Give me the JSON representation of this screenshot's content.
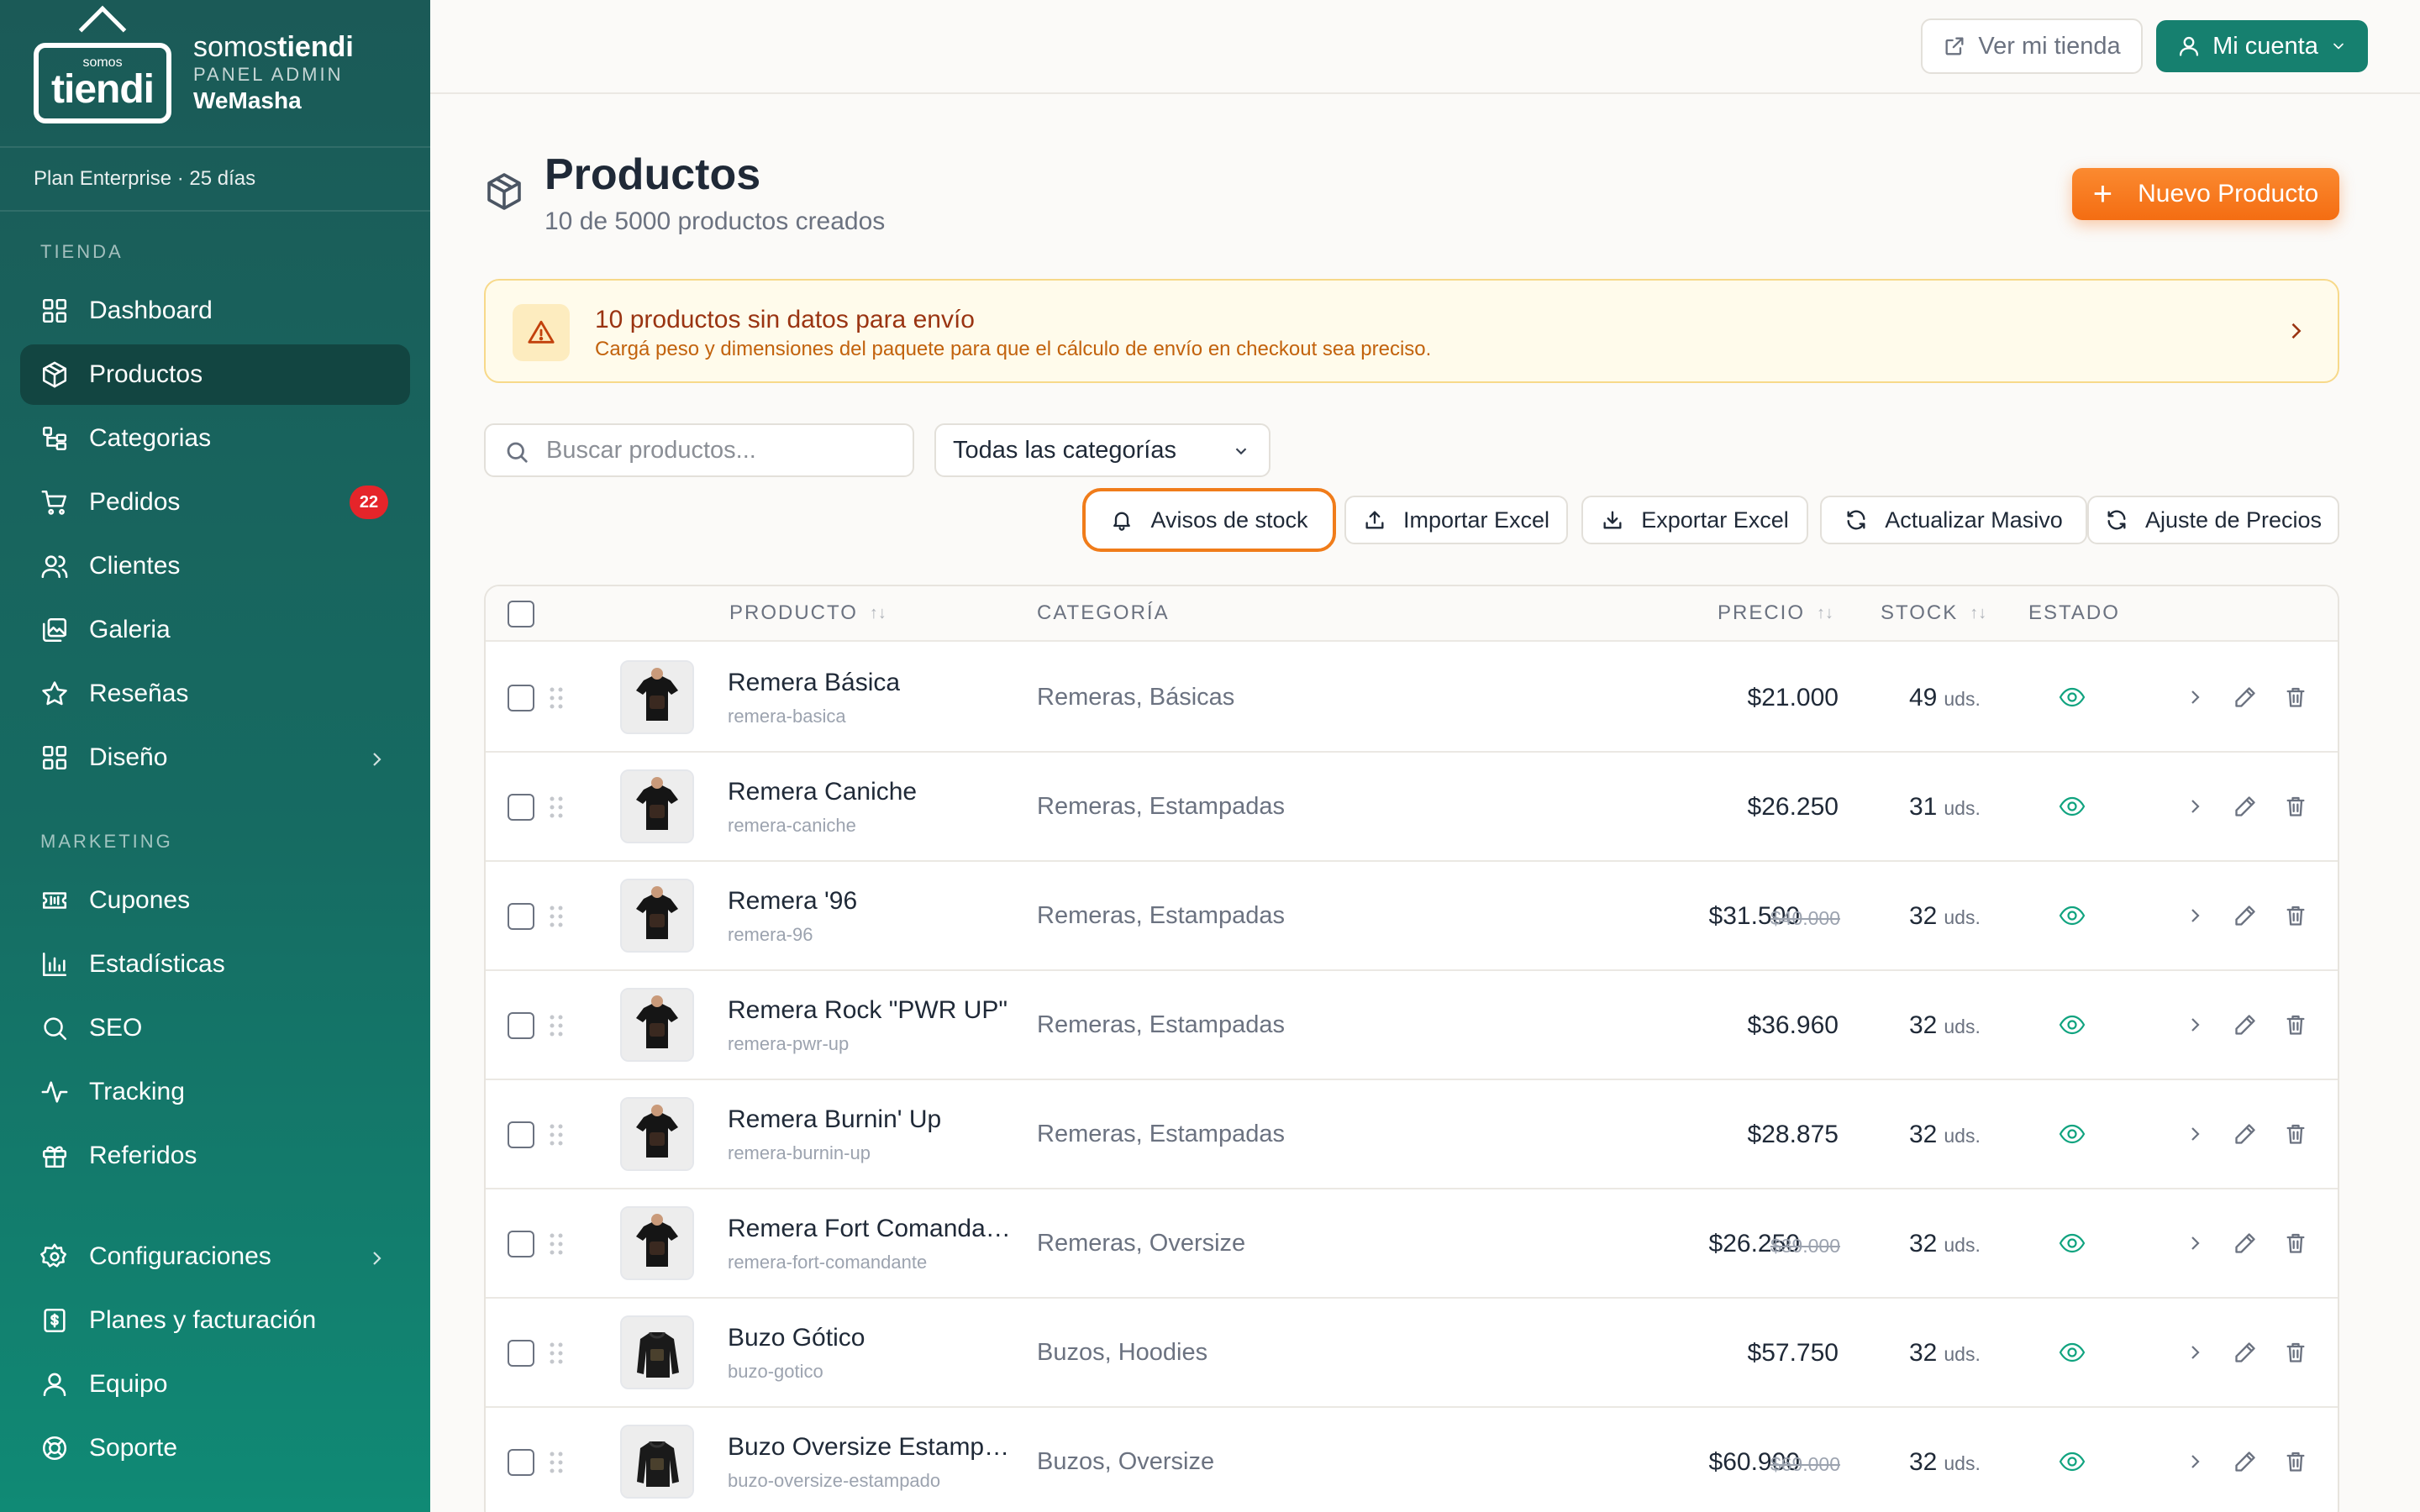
{
  "brand": {
    "logo_small": "somos",
    "logo_big": "tiendi",
    "name_light": "somos",
    "name_bold": "tiendi",
    "panel": "PANEL ADMIN",
    "store": "WeMasha"
  },
  "plan": "Plan Enterprise · 25 días",
  "sidebar": {
    "section_tienda": "TIENDA",
    "section_marketing": "MARKETING",
    "items": [
      {
        "label": "Dashboard",
        "icon": "grid-icon"
      },
      {
        "label": "Productos",
        "icon": "package-icon"
      },
      {
        "label": "Categorias",
        "icon": "category-tree-icon"
      },
      {
        "label": "Pedidos",
        "icon": "cart-icon",
        "badge": "22"
      },
      {
        "label": "Clientes",
        "icon": "users-icon"
      },
      {
        "label": "Galeria",
        "icon": "gallery-icon"
      },
      {
        "label": "Reseñas",
        "icon": "star-icon"
      },
      {
        "label": "Diseño",
        "icon": "layout-icon"
      },
      {
        "label": "Cupones",
        "icon": "ticket-icon"
      },
      {
        "label": "Estadísticas",
        "icon": "bar-chart-icon"
      },
      {
        "label": "SEO",
        "icon": "search-icon"
      },
      {
        "label": "Tracking",
        "icon": "activity-icon"
      },
      {
        "label": "Referidos",
        "icon": "gift-icon"
      },
      {
        "label": "Configuraciones",
        "icon": "gear-icon"
      },
      {
        "label": "Planes y facturación",
        "icon": "receipt-icon"
      },
      {
        "label": "Equipo",
        "icon": "user-icon"
      },
      {
        "label": "Soporte",
        "icon": "lifebuoy-icon"
      }
    ]
  },
  "topbar": {
    "store_button": "Ver mi tienda",
    "account_button": "Mi cuenta"
  },
  "header": {
    "title": "Productos",
    "subtitle": "10 de 5000 productos creados",
    "new_button": "Nuevo Producto",
    "new_button_plus": "+"
  },
  "alert": {
    "title": "10 productos sin datos para envío",
    "description": "Cargá peso y dimensiones del paquete para que el cálculo de envío en checkout sea preciso."
  },
  "filters": {
    "search_placeholder": "Buscar productos...",
    "category_selected": "Todas las categorías"
  },
  "toolbar": {
    "stock_alerts": "Avisos de stock",
    "import_excel": "Importar Excel",
    "export_excel": "Exportar Excel",
    "bulk_update": "Actualizar Masivo",
    "price_adjust": "Ajuste de Precios"
  },
  "table": {
    "columns": {
      "product": "PRODUCTO",
      "category": "CATEGORÍA",
      "price": "PRECIO",
      "stock": "STOCK",
      "status": "ESTADO",
      "sort_glyph": "↑↓"
    },
    "unit": "uds.",
    "rows": [
      {
        "name": "Remera Básica",
        "slug": "remera-basica",
        "category": "Remeras, Básicas",
        "price": "$21.000",
        "old_price": "",
        "stock": "49"
      },
      {
        "name": "Remera Caniche",
        "slug": "remera-caniche",
        "category": "Remeras, Estampadas",
        "price": "$26.250",
        "old_price": "",
        "stock": "31"
      },
      {
        "name": "Remera '96",
        "slug": "remera-96",
        "category": "Remeras, Estampadas",
        "price": "$31.500",
        "old_price": "$40.000",
        "stock": "32"
      },
      {
        "name": "Remera Rock \"PWR UP\"",
        "slug": "remera-pwr-up",
        "category": "Remeras, Estampadas",
        "price": "$36.960",
        "old_price": "",
        "stock": "32"
      },
      {
        "name": "Remera Burnin' Up",
        "slug": "remera-burnin-up",
        "category": "Remeras, Estampadas",
        "price": "$28.875",
        "old_price": "",
        "stock": "32"
      },
      {
        "name": "Remera Fort Comandan...",
        "slug": "remera-fort-comandante",
        "category": "Remeras, Oversize",
        "price": "$26.250",
        "old_price": "$39.000",
        "stock": "32"
      },
      {
        "name": "Buzo Gótico",
        "slug": "buzo-gotico",
        "category": "Buzos, Hoodies",
        "price": "$57.750",
        "old_price": "",
        "stock": "32"
      },
      {
        "name": "Buzo Oversize Estampa...",
        "slug": "buzo-oversize-estampado",
        "category": "Buzos, Oversize",
        "price": "$60.900",
        "old_price": "$69.000",
        "stock": "32"
      }
    ]
  },
  "colors": {
    "sidebar_top": "#1b5a57",
    "sidebar_bottom": "#108a75",
    "accent_orange": "#f46d12",
    "account_green": "#16806f",
    "badge_red": "#e5252a",
    "status_green": "#10a37f"
  }
}
